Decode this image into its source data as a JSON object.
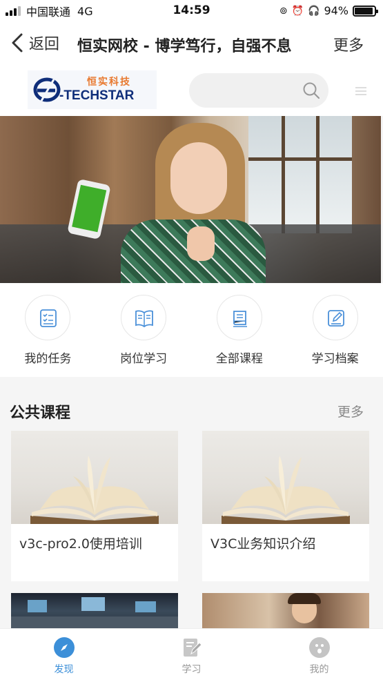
{
  "status_bar": {
    "carrier": "中国联通",
    "network": "4G",
    "time": "14:59",
    "battery": "94%",
    "battery_level": 0.94
  },
  "nav": {
    "back_label": "返回",
    "title": "恒实网校 - 博学笃行，自强不息",
    "more_label": "更多"
  },
  "header": {
    "logo_cn": "恒实科技",
    "logo_en": "-TECHSTAR",
    "search_placeholder": ""
  },
  "quick_entries": [
    {
      "label": "我的任务",
      "icon": "task-list-icon"
    },
    {
      "label": "岗位学习",
      "icon": "open-book-icon"
    },
    {
      "label": "全部课程",
      "icon": "course-book-icon"
    },
    {
      "label": "学习档案",
      "icon": "edit-record-icon"
    }
  ],
  "public_courses": {
    "title": "公共课程",
    "more_label": "更多",
    "courses": [
      {
        "title": "v3c-pro2.0使用培训"
      },
      {
        "title": "V3C业务知识介绍"
      }
    ]
  },
  "tab_bar": {
    "tabs": [
      {
        "label": "发现",
        "icon": "compass-icon",
        "active": true
      },
      {
        "label": "学习",
        "icon": "notebook-pen-icon",
        "active": false
      },
      {
        "label": "我的",
        "icon": "profile-face-icon",
        "active": false
      }
    ]
  },
  "colors": {
    "accent": "#3c8fd8",
    "quick_icon": "#4a90d9",
    "logo_orange": "#e8792f",
    "logo_blue": "#0f2e7a"
  }
}
